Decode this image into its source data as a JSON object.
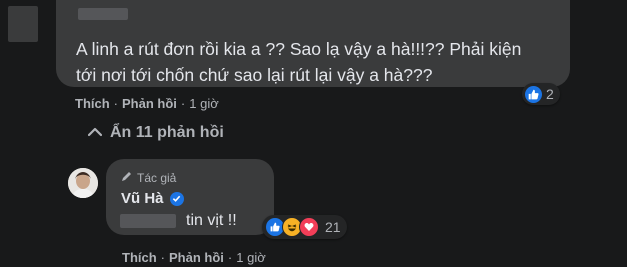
{
  "colors": {
    "accent": "#1b74e4",
    "love": "#f33e58",
    "haha": "#f7b125",
    "bubble": "#3a3b3c",
    "background": "#18191a"
  },
  "comment": {
    "text": "A linh a rút đơn rồi kia a ?? Sao lạ vậy a hà!!!?? Phải kiện\ntới nơi tới chốn chứ sao lại rút lại vậy a hà???",
    "reaction_count": "2",
    "actions": {
      "like": "Thích",
      "sep": "·",
      "reply": "Phản hồi",
      "time": "1 giờ"
    }
  },
  "hidden_replies": {
    "label": "Ẩn 11 phản hồi",
    "icon": "chevron-up-icon"
  },
  "reply": {
    "author_badge": "Tác giả",
    "author_name": "Vũ Hà",
    "text": "tin vịt !!",
    "reaction_count": "21",
    "actions": {
      "like": "Thích",
      "sep": "·",
      "reply": "Phản hồi",
      "time": "1 giờ"
    }
  }
}
